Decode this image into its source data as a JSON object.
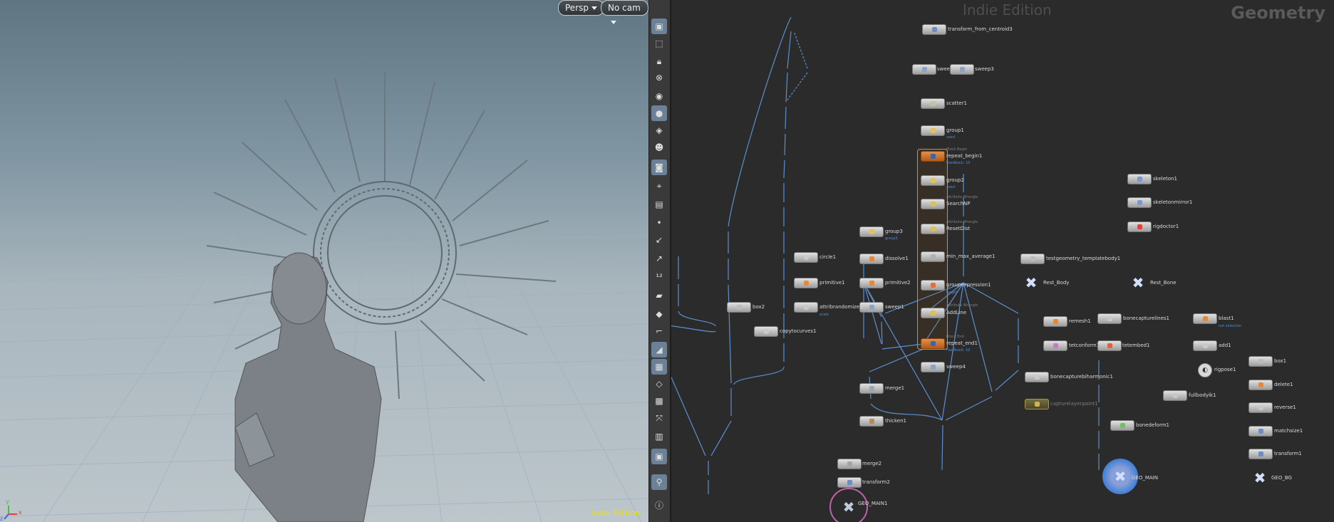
{
  "viewport": {
    "camera_menu": "Persp",
    "cam_menu": "No cam",
    "watermark": "Indie Edition",
    "axis_x": "x",
    "axis_y": "y",
    "axis_z": "z"
  },
  "toolbar_icons": [
    "select-pose-icon",
    "handle-icon",
    "lock-icon",
    "snap-icon",
    "lighting-icon",
    "light-icon",
    "ghost-icon",
    "display-icon",
    "camera-icon",
    "view-options-icon",
    "template-icon",
    "points-icon",
    "normals-icon",
    "pick-icon",
    "numbers-icon",
    "paint-icon",
    "sculpt-icon",
    "guide-icon",
    "visibility-icon",
    "grid-icon",
    "shading-icon",
    "frame-icon",
    "pivot-icon",
    "background-icon",
    "render-icon",
    "pin-icon",
    "info-icon"
  ],
  "network": {
    "watermark": "Indie Edition",
    "context_label": "Geometry",
    "nodes": {
      "transform_from_centroid3": {
        "label": "transform_from_centroid3"
      },
      "sweep2": {
        "label": "sweep2"
      },
      "sweep3": {
        "label": "sweep3"
      },
      "scatter1": {
        "label": "scatter1"
      },
      "group1": {
        "label": "group1",
        "sub": "seed"
      },
      "repeat_begin1": {
        "label": "repeat_begin1",
        "sub": "Feedback: 10",
        "badge": "Block Begin"
      },
      "group2": {
        "label": "group2",
        "sub": "seed"
      },
      "SearchNP": {
        "label": "SearchNP",
        "badge": "Attribute Wrangle"
      },
      "ResetDist": {
        "label": "ResetDist",
        "badge": "Attribute Wrangle"
      },
      "min_max_average1": {
        "label": "min_max_average1"
      },
      "groupexpression1": {
        "label": "groupexpression1",
        "sub": "target"
      },
      "AddLine": {
        "label": "AddLine",
        "badge": "Attribute Wrangle"
      },
      "repeat_end1": {
        "label": "repeat_end1",
        "sub": "Feedback: 10",
        "badge": "Block End"
      },
      "sweep4": {
        "label": "sweep4"
      },
      "group3": {
        "label": "group3",
        "sub": "group3"
      },
      "dissolve1": {
        "label": "dissolve1"
      },
      "primitive2": {
        "label": "primitive2"
      },
      "sweep1": {
        "label": "sweep1"
      },
      "circle1": {
        "label": "circle1"
      },
      "primitive1": {
        "label": "primitive1"
      },
      "attribrandomize1": {
        "label": "attribrandomize1",
        "sub": "scale"
      },
      "box2": {
        "label": "box2"
      },
      "copytocurves1": {
        "label": "copytocurves1"
      },
      "merge1": {
        "label": "merge1"
      },
      "thicken1": {
        "label": "thicken1"
      },
      "merge2": {
        "label": "merge2"
      },
      "transform2": {
        "label": "transform2"
      },
      "GEO_MAIN1": {
        "label": "GEO_MAIN1"
      },
      "testgeometry_templatebody1": {
        "label": "testgeometry_templatebody1"
      },
      "Rest_Body": {
        "label": "Rest_Body"
      },
      "remesh1": {
        "label": "remesh1"
      },
      "tetconform1": {
        "label": "tetconform1"
      },
      "tetembed1": {
        "label": "tetembed1"
      },
      "bonecapturelines1": {
        "label": "bonecapturelines1"
      },
      "bonecapturebiharmonic1": {
        "label": "bonecapturebiharmonic1"
      },
      "capturelayerpaint1": {
        "label": "capturelayerpaint1"
      },
      "skeleton1": {
        "label": "skeleton1"
      },
      "skeletonmirror1": {
        "label": "skeletonmirror1"
      },
      "rigdoctor1": {
        "label": "rigdoctor1"
      },
      "Rest_Bone": {
        "label": "Rest_Bone"
      },
      "blast1": {
        "label": "blast1",
        "sub": "not selection"
      },
      "add1": {
        "label": "add1"
      },
      "rigpose1": {
        "label": "rigpose1"
      },
      "fullbodyik1": {
        "label": "fullbodyik1"
      },
      "bonedeform1": {
        "label": "bonedeform1"
      },
      "GEO_MAIN": {
        "label": "GEO_MAIN"
      },
      "box1": {
        "label": "box1"
      },
      "delete1": {
        "label": "delete1"
      },
      "reverse1": {
        "label": "reverse1"
      },
      "matchsize1": {
        "label": "matchsize1"
      },
      "transform1": {
        "label": "transform1"
      },
      "GEO_BG": {
        "label": "GEO_BG"
      }
    }
  },
  "colors": {
    "wire": "#5d8fd0",
    "loop_frame": "#e08a2c",
    "selected_output_ring": "#3f7fd6",
    "output_ring_main1": "#c060b0",
    "viewport_watermark": "#e8e020"
  }
}
